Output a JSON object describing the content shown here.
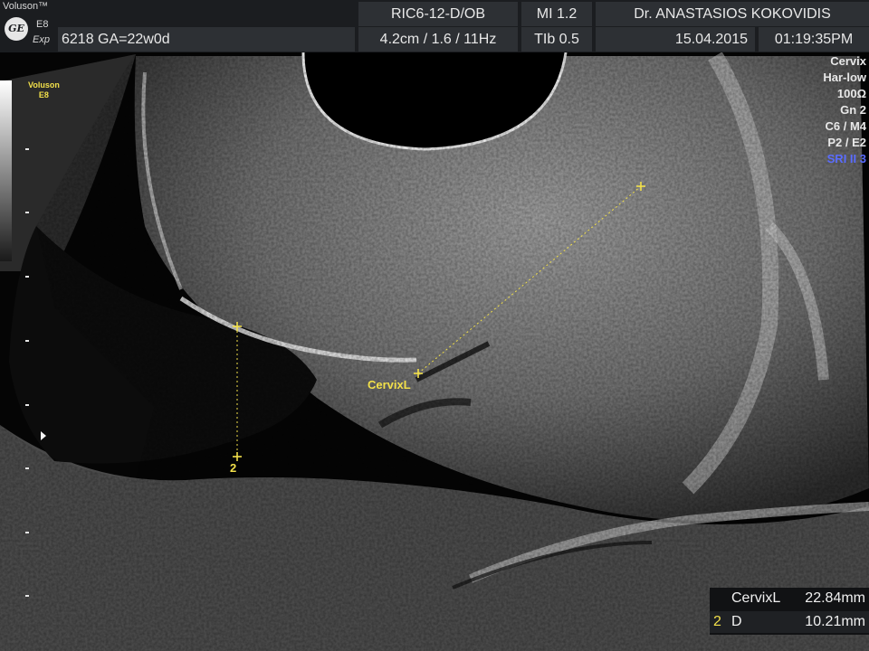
{
  "header": {
    "brand": "Voluson™",
    "logo_text": "GE",
    "model": "E8",
    "mode": "Exp",
    "probe": "RIC6-12-D/OB",
    "mi": "MI  1.2",
    "physician": "Dr. ANASTASIOS KOKOVIDIS",
    "patient": "6218  GA=22w0d",
    "depth_info": "4.2cm / 1.6 / 11Hz",
    "tib": "TIb  0.5",
    "date": "15.04.2015",
    "time": "01:19:35PM"
  },
  "sidebar": {
    "voluson_label": "Voluson",
    "model_label": "E8"
  },
  "params": [
    "Cervix",
    "Har-low",
    "100Ω",
    "Gn  2",
    "C6 / M4",
    "P2 / E2",
    "SRI II 3"
  ],
  "measurements": {
    "cervix_label": "CervixL",
    "d_label": "2"
  },
  "results": [
    {
      "index": "",
      "name": "CervixL",
      "value": "22.84mm"
    },
    {
      "index": "2",
      "name": "D",
      "value": "10.21mm"
    }
  ],
  "colors": {
    "caliper": "#f2e04a",
    "sri": "#5a6cff",
    "header_cell": "#2d3034"
  }
}
